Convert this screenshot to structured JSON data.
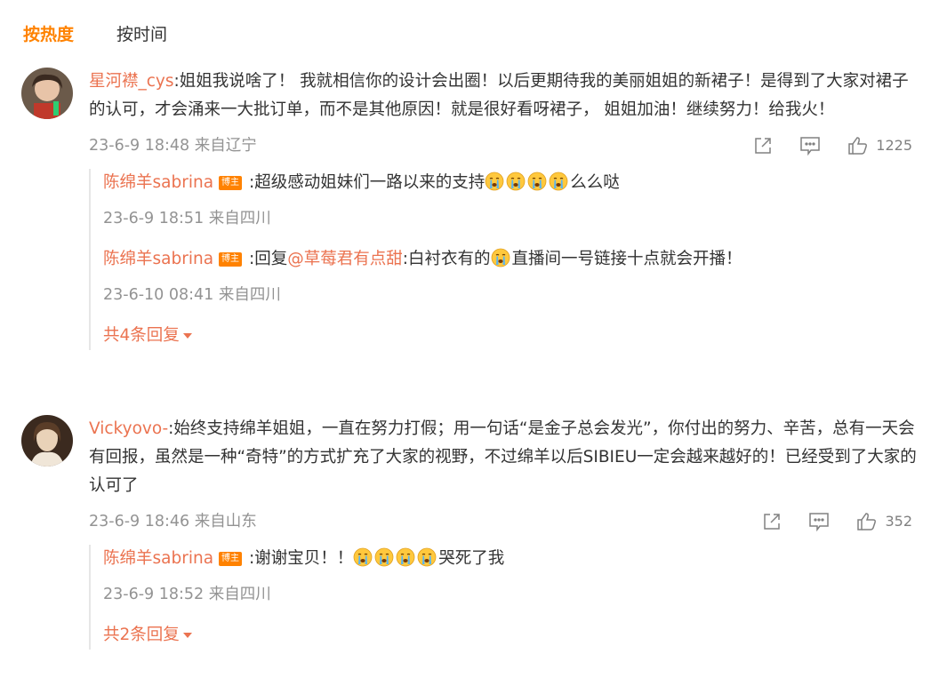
{
  "tabs": {
    "hot": "按热度",
    "time": "按时间"
  },
  "colors": {
    "accent": "#ff8200",
    "username": "#eb7350",
    "meta": "#939393"
  },
  "comments": [
    {
      "user": "星河襟_cys",
      "text": ":姐姐我说啥了！ 我就相信你的设计会出圈！以后更期待我的美丽姐姐的新裙子！是得到了大家对裙子的认可，才会涌来一大批订单，而不是其他原因！就是很好看呀裙子， 姐姐加油！继续努力！给我火！",
      "meta": "23-6-9 18:48 来自辽宁",
      "likes": "1225",
      "replies": [
        {
          "user": "陈绵羊sabrina",
          "badge": "博主",
          "text_before": ":超级感动姐妹们一路以来的支持",
          "emoji_count": 4,
          "text_after": "么么哒",
          "meta": "23-6-9 18:51 来自四川"
        },
        {
          "user": "陈绵羊sabrina",
          "badge": "博主",
          "text_before": ":回复",
          "mention": "@草莓君有点甜",
          "text_mid": ":白衬衣有的",
          "emoji_count": 1,
          "text_after": "直播间一号链接十点就会开播！",
          "meta": "23-6-10 08:41 来自四川"
        }
      ],
      "more": "共4条回复"
    },
    {
      "user": "Vickyovo-",
      "text": ":始终支持绵羊姐姐，一直在努力打假；用一句话“是金子总会发光”，你付出的努力、辛苦，总有一天会有回报，虽然是一种“奇特”的方式扩充了大家的视野，不过绵羊以后SIBIEU一定会越来越好的！已经受到了大家的认可了",
      "meta": "23-6-9 18:46 来自山东",
      "likes": "352",
      "replies": [
        {
          "user": "陈绵羊sabrina",
          "badge": "博主",
          "text_before": ":谢谢宝贝！！",
          "emoji_count": 4,
          "text_after": "哭死了我",
          "meta": "23-6-9 18:52 来自四川"
        }
      ],
      "more": "共2条回复"
    }
  ]
}
